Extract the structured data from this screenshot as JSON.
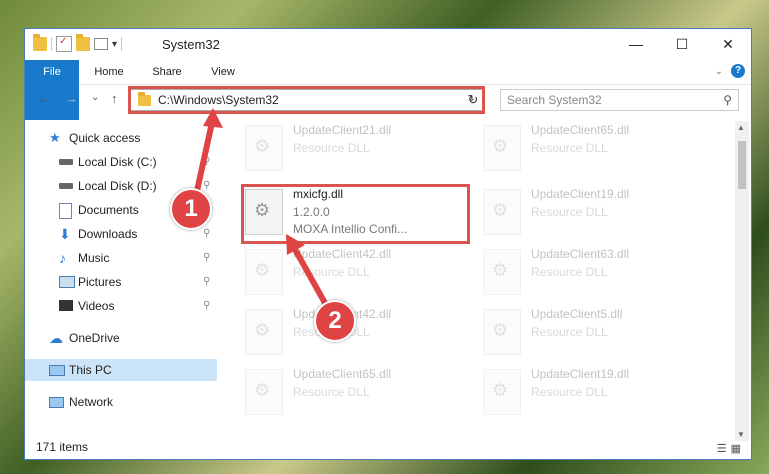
{
  "window": {
    "title": "System32",
    "controls": {
      "minimize": "—",
      "maximize": "☐",
      "close": "✕"
    }
  },
  "ribbon": {
    "tabs": [
      "File",
      "Home",
      "Share",
      "View"
    ],
    "expand_icon": "chevron-down",
    "help_label": "?"
  },
  "navigation": {
    "back": "←",
    "forward": "→",
    "recent": "⌄",
    "up": "↑",
    "address": "C:\\Windows\\System32",
    "address_dropdown": "⌄",
    "refresh": "↻",
    "search_placeholder": "Search System32",
    "search_icon": "⚲"
  },
  "sidebar": {
    "items": [
      {
        "label": "Quick access",
        "icon": "star-icon"
      },
      {
        "label": "Local Disk (C:)",
        "icon": "drive-icon"
      },
      {
        "label": "Local Disk (D:)",
        "icon": "drive-icon"
      },
      {
        "label": "Documents",
        "icon": "documents-icon"
      },
      {
        "label": "Downloads",
        "icon": "download-icon"
      },
      {
        "label": "Music",
        "icon": "music-icon"
      },
      {
        "label": "Pictures",
        "icon": "pictures-icon"
      },
      {
        "label": "Videos",
        "icon": "videos-icon"
      },
      {
        "label": "OneDrive",
        "icon": "cloud-icon"
      },
      {
        "label": "This PC",
        "icon": "computer-icon"
      },
      {
        "label": "Network",
        "icon": "network-icon"
      }
    ],
    "pin_glyph": "📌"
  },
  "files": {
    "selected": {
      "name": "mxicfg.dll",
      "version": "1.2.0.0",
      "description": "MOXA Intellio Confi..."
    },
    "background": [
      {
        "name": "UpdateClient21.dll",
        "type": "Resource DLL"
      },
      {
        "name": "UpdateClient65.dll",
        "type": "Resource DLL"
      },
      {
        "name": "UpdateClient19.dll",
        "type": "Resource DLL"
      },
      {
        "name": "UpdateClient42.dll",
        "type": "Resource DLL"
      },
      {
        "name": "UpdateClient63.dll",
        "type": "Resource DLL"
      },
      {
        "name": "UpdateClient42.dll",
        "type": "Resource DLL"
      },
      {
        "name": "UpdateClient5.dll",
        "type": "Resource DLL"
      },
      {
        "name": "UpdateClient65.dll",
        "type": "Resource DLL"
      },
      {
        "name": "UpdateClient19.dll",
        "type": "Resource DLL"
      }
    ]
  },
  "status": {
    "item_count": "171 items"
  },
  "annotations": {
    "step1": "1",
    "step2": "2",
    "color": "#e04343"
  }
}
